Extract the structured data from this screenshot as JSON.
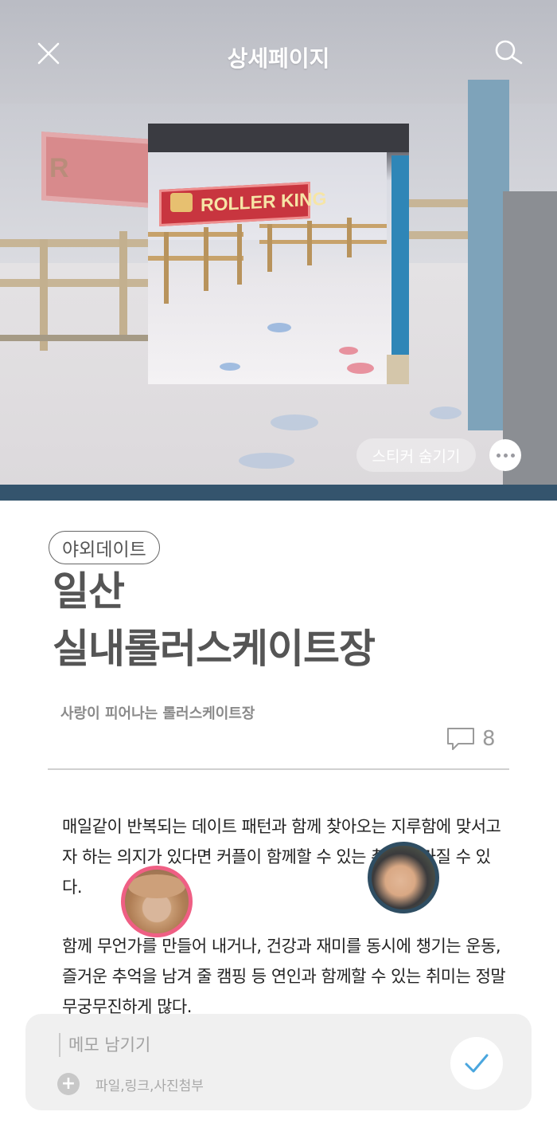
{
  "header": {
    "title": "상세페이지",
    "close_icon": "close-icon",
    "search_icon": "search-icon"
  },
  "hero": {
    "sticker_hide_label": "스티커 숨기기",
    "more_icon": "more-dots-icon",
    "photo_sign_text": "ROLLER KING"
  },
  "article": {
    "tag": "야외데이트",
    "title_line1": "일산",
    "title_line2": "실내롤러스케이트장",
    "subtitle": "사랑이 피어나는 롤러스케이트장",
    "comment_count": "8",
    "comment_icon": "speech-bubble-icon",
    "paragraphs": [
      "매일같이 반복되는 데이트 패턴과 함께 찾아오는 지루함에 맞서고자 하는 의지가 있다면 커플이 함께할 수 있는 취미를 가질 수 있다.",
      "함께 무언가를 만들어 내거나, 건강과 재미를 동시에 챙기는 운동, 즐거운 추억을 남겨 줄 캠핑 등 연인과 함께할 수 있는 취미는 정말 무궁무진하게 많다."
    ]
  },
  "memo": {
    "placeholder": "메모 남기기",
    "attach_label": "파일,링크,사진첨부",
    "submit_icon": "checkmark-icon"
  },
  "colors": {
    "hero_bottom_bar": "#34546d",
    "avatar1_border": "#ef5f84",
    "avatar2_border": "#2f4e63",
    "check_color": "#4aa6de"
  }
}
